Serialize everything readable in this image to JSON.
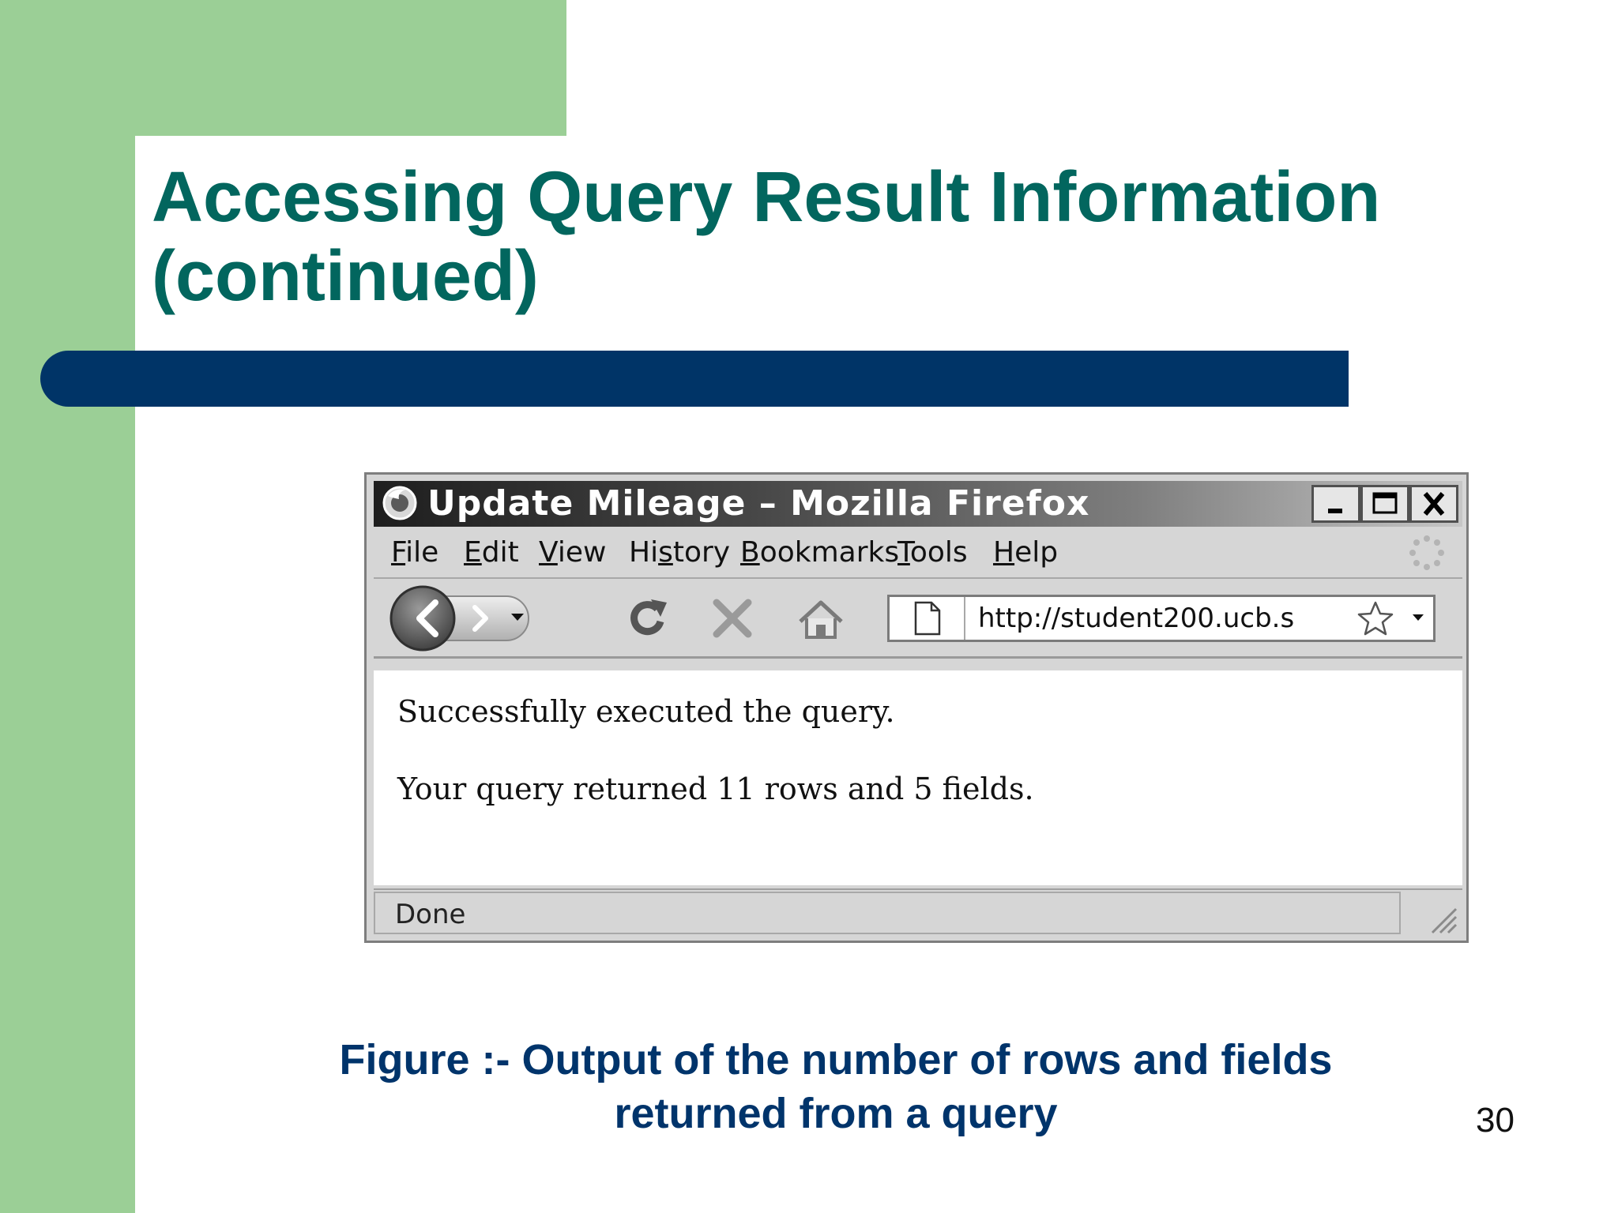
{
  "slide": {
    "title_line1": "Accessing Query Result Information",
    "title_line2": "(continued)",
    "caption_line1": "Figure :- Output of the number of rows and fields",
    "caption_line2": "returned from a query",
    "page_number": "30"
  },
  "browser": {
    "window_title": "Update Mileage – Mozilla Firefox",
    "menu": [
      {
        "label": "File",
        "mnemonic": "F",
        "rest": "ile"
      },
      {
        "label": "Edit",
        "mnemonic": "E",
        "rest": "dit"
      },
      {
        "label": "View",
        "mnemonic": "V",
        "rest": "iew"
      },
      {
        "label": "History",
        "pre": "Hi",
        "mnemonic": "s",
        "rest": "tory"
      },
      {
        "label": "Bookmarks",
        "mnemonic": "B",
        "rest": "ookmarks"
      },
      {
        "label": "Tools",
        "mnemonic": "T",
        "rest": "ools"
      },
      {
        "label": "Help",
        "mnemonic": "H",
        "rest": "elp"
      }
    ],
    "url": "http://student200.ucb.s",
    "content": {
      "line1": "Successfully executed the query.",
      "line2": "Your query returned 11 rows and 5 fields."
    },
    "status": "Done"
  },
  "colors": {
    "sidebar_green": "#9bcf96",
    "title_teal": "#02665e",
    "bar_navy": "#003467",
    "caption_navy": "#00346b"
  },
  "icons": [
    "firefox-icon",
    "minimize-icon",
    "maximize-icon",
    "close-icon",
    "throbber-icon",
    "back-arrow-icon",
    "forward-arrow-icon",
    "history-dropdown-icon",
    "reload-icon",
    "stop-icon",
    "home-icon",
    "page-icon",
    "bookmark-star-icon",
    "url-dropdown-icon",
    "resize-grip-icon"
  ]
}
